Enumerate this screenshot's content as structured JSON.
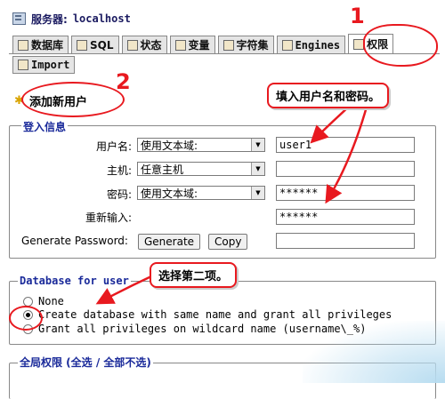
{
  "header": {
    "server_label": "服务器:",
    "server_host": "localhost"
  },
  "tabs": [
    {
      "label": "数据库",
      "icon": "database-icon"
    },
    {
      "label": "SQL",
      "icon": "sql-icon"
    },
    {
      "label": "状态",
      "icon": "status-icon"
    },
    {
      "label": "变量",
      "icon": "variables-icon"
    },
    {
      "label": "字符集",
      "icon": "charset-icon"
    },
    {
      "label": "Engines",
      "icon": "engines-icon"
    },
    {
      "label": "权限",
      "icon": "privileges-icon",
      "active": true
    }
  ],
  "tabs_row2": [
    {
      "label": "Import",
      "icon": "import-icon"
    }
  ],
  "page": {
    "add_user_title": "添加新用户"
  },
  "login": {
    "legend": "登入信息",
    "username_label": "用户名:",
    "username_mode": "使用文本域:",
    "username_value": "user1",
    "host_label": "主机:",
    "host_mode": "任意主机",
    "host_value": "",
    "password_label": "密码:",
    "password_mode": "使用文本域:",
    "password_value": "******",
    "retype_label": "重新输入:",
    "retype_value": "******",
    "generate_label": "Generate Password:",
    "generate_button": "Generate",
    "copy_button": "Copy",
    "generated_value": ""
  },
  "database": {
    "legend": "Database for user",
    "options": [
      {
        "label": "None",
        "selected": false
      },
      {
        "label": "Create database with same name and grant all privileges",
        "selected": true
      },
      {
        "label": "Grant all privileges on wildcard name (username\\_%)",
        "selected": false
      }
    ]
  },
  "global": {
    "legend": "全局权限 (全选 / 全部不选)"
  },
  "annotations": {
    "num1": "1",
    "num2": "2",
    "callout_fill": "填入用户名和密码。",
    "callout_second": "选择第二项。",
    "color": "#e8191f"
  }
}
